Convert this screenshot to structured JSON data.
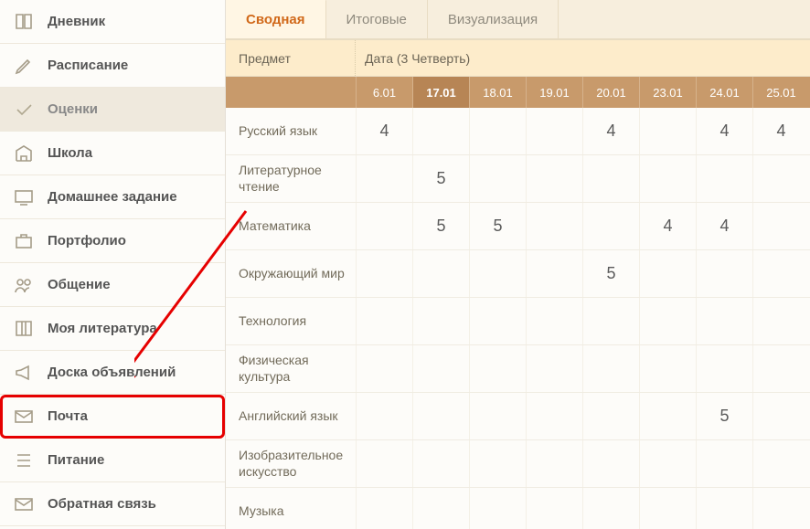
{
  "sidebar": {
    "items": [
      {
        "label": "Дневник",
        "icon": "book-icon"
      },
      {
        "label": "Расписание",
        "icon": "pen-icon"
      },
      {
        "label": "Оценки",
        "icon": "check-icon",
        "active": true
      },
      {
        "label": "Школа",
        "icon": "building-icon"
      },
      {
        "label": "Домашнее задание",
        "icon": "board-icon"
      },
      {
        "label": "Портфолио",
        "icon": "briefcase-icon"
      },
      {
        "label": "Общение",
        "icon": "people-icon"
      },
      {
        "label": "Моя литература",
        "icon": "books-icon"
      },
      {
        "label": "Доска объявлений",
        "icon": "megaphone-icon"
      },
      {
        "label": "Почта",
        "icon": "mail-icon",
        "highlight": true
      },
      {
        "label": "Питание",
        "icon": "list-icon"
      },
      {
        "label": "Обратная связь",
        "icon": "envelope-icon"
      }
    ]
  },
  "tabs": [
    {
      "label": "Сводная",
      "active": true
    },
    {
      "label": "Итоговые"
    },
    {
      "label": "Визуализация"
    }
  ],
  "filter": {
    "subject_label": "Предмет",
    "date_label": "Дата (3 Четверть)"
  },
  "dates": [
    "6.01",
    "17.01",
    "18.01",
    "19.01",
    "20.01",
    "23.01",
    "24.01",
    "25.01"
  ],
  "selected_date_index": 1,
  "rows": [
    {
      "subject": "Русский язык",
      "grades": [
        "4",
        "",
        "",
        "",
        "4",
        "",
        "4",
        "4"
      ]
    },
    {
      "subject": "Литературное чтение",
      "grades": [
        "",
        "5",
        "",
        "",
        "",
        "",
        "",
        ""
      ]
    },
    {
      "subject": "Математика",
      "grades": [
        "",
        "5",
        "5",
        "",
        "",
        "4",
        "4",
        ""
      ]
    },
    {
      "subject": "Окружающий мир",
      "grades": [
        "",
        "",
        "",
        "",
        "5",
        "",
        "",
        ""
      ]
    },
    {
      "subject": "Технология",
      "grades": [
        "",
        "",
        "",
        "",
        "",
        "",
        "",
        ""
      ]
    },
    {
      "subject": "Физическая культура",
      "grades": [
        "",
        "",
        "",
        "",
        "",
        "",
        "",
        ""
      ]
    },
    {
      "subject": "Английский язык",
      "grades": [
        "",
        "",
        "",
        "",
        "",
        "",
        "5",
        ""
      ]
    },
    {
      "subject": "Изобразительное искусство",
      "grades": [
        "",
        "",
        "",
        "",
        "",
        "",
        "",
        ""
      ]
    },
    {
      "subject": "Музыка",
      "grades": [
        "",
        "",
        "",
        "",
        "",
        "",
        "",
        ""
      ]
    }
  ]
}
